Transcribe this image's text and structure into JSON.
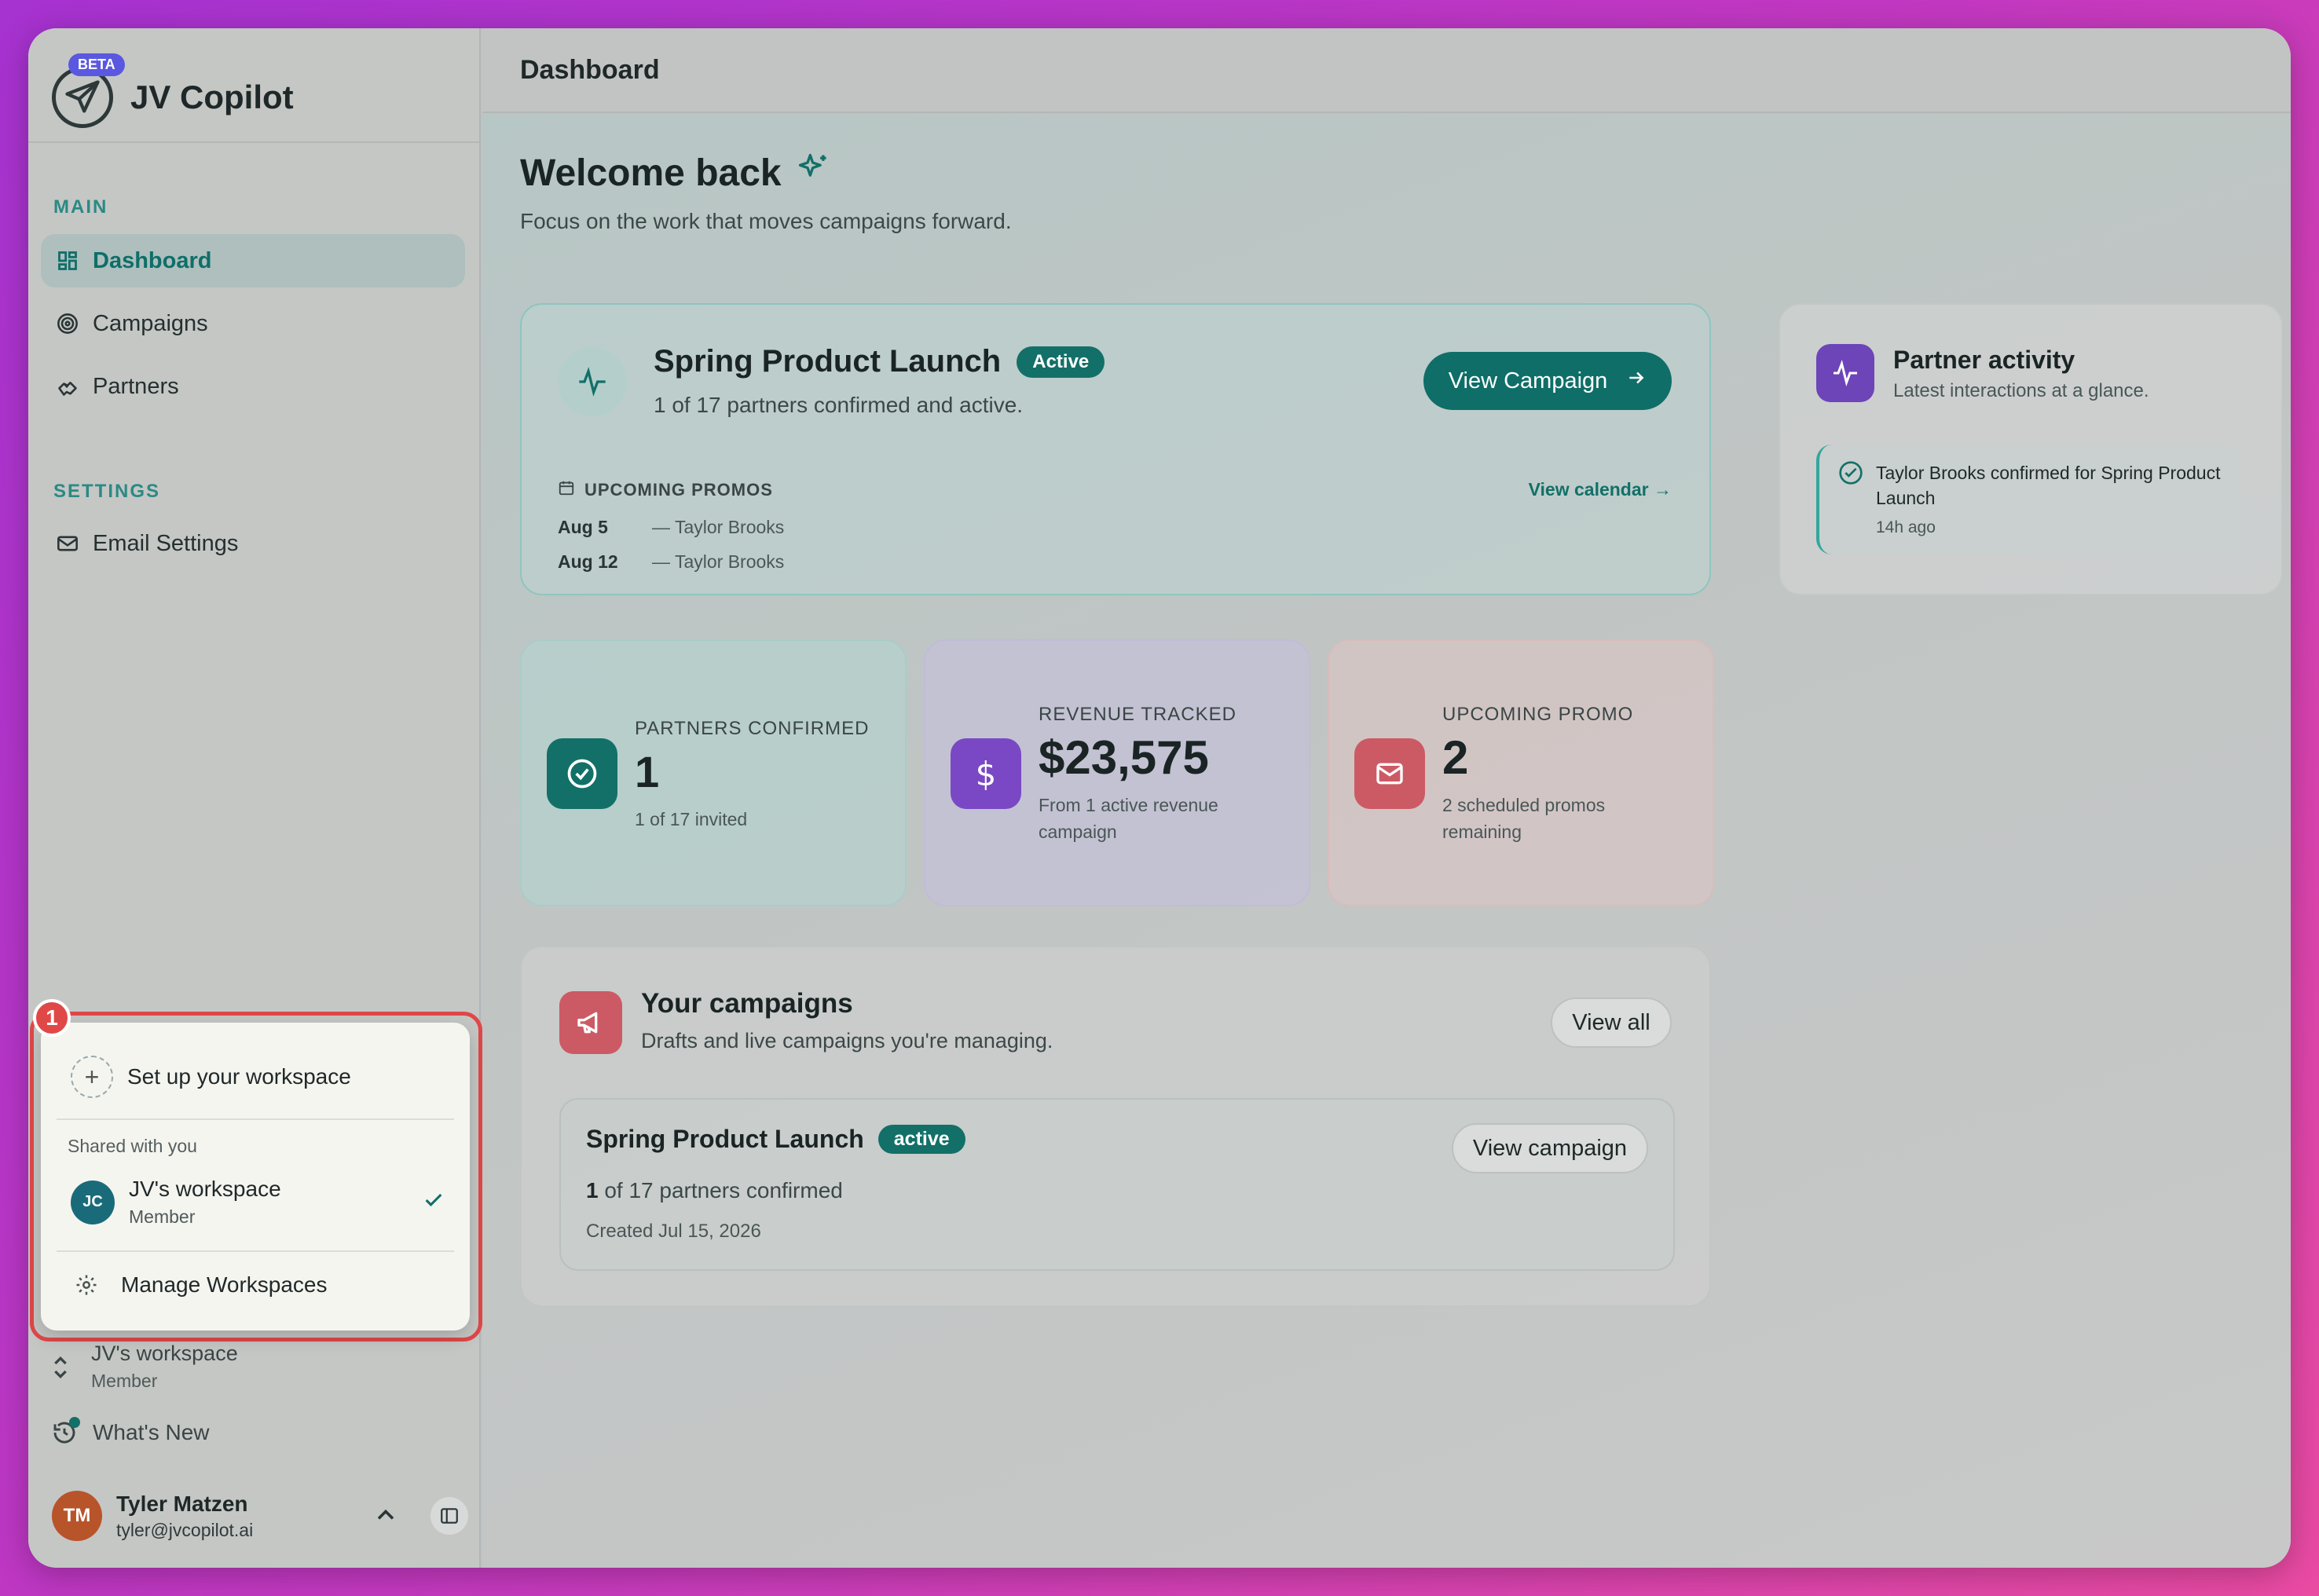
{
  "app": {
    "name": "JV Copilot",
    "beta_label": "BETA"
  },
  "sidebar": {
    "main_label": "MAIN",
    "settings_label": "SETTINGS",
    "items": [
      {
        "label": "Dashboard",
        "icon": "dashboard-grid-icon"
      },
      {
        "label": "Campaigns",
        "icon": "target-icon"
      },
      {
        "label": "Partners",
        "icon": "handshake-icon"
      },
      {
        "label": "Email Settings",
        "icon": "mail-icon"
      }
    ],
    "workspace_menu": {
      "badge": "1",
      "setup_label": "Set up your workspace",
      "shared_label": "Shared with you",
      "workspace_initials": "JC",
      "workspace_name": "JV's workspace",
      "workspace_role": "Member",
      "manage_label": "Manage Workspaces"
    },
    "current_workspace": {
      "name": "JV's workspace",
      "role": "Member"
    },
    "whats_new": "What's New",
    "user": {
      "initials": "TM",
      "name": "Tyler Matzen",
      "email": "tyler@jvcopilot.ai"
    }
  },
  "header": {
    "title": "Dashboard"
  },
  "welcome": {
    "title": "Welcome back",
    "subtitle": "Focus on the work that moves campaigns forward."
  },
  "hero": {
    "title": "Spring Product Launch",
    "status": "Active",
    "subtitle": "1 of 17 partners confirmed and active.",
    "button": "View Campaign",
    "promos_label": "UPCOMING PROMOS",
    "calendar_link": "View calendar →",
    "promos": [
      {
        "date": "Aug 5",
        "partner": "— Taylor Brooks"
      },
      {
        "date": "Aug 12",
        "partner": "— Taylor Brooks"
      }
    ]
  },
  "activity": {
    "title": "Partner activity",
    "subtitle": "Latest interactions at a glance.",
    "items": [
      {
        "text": "Taylor Brooks confirmed for Spring Product Launch",
        "time": "14h ago"
      }
    ]
  },
  "stats": [
    {
      "label": "PARTNERS CONFIRMED",
      "value": "1",
      "sub": "1 of 17 invited",
      "icon": "check-circle-icon",
      "color": "#127068"
    },
    {
      "label": "REVENUE TRACKED",
      "value": "$23,575",
      "sub": "From 1 active revenue campaign",
      "icon": "dollar-icon",
      "color": "#7a48c4"
    },
    {
      "label": "UPCOMING PROMO",
      "value": "2",
      "sub": "2 scheduled promos remaining",
      "icon": "mail-icon",
      "color": "#cc5a64"
    }
  ],
  "campaigns": {
    "title": "Your campaigns",
    "subtitle": "Drafts and live campaigns you're managing.",
    "view_all": "View all",
    "list": [
      {
        "name": "Spring Product Launch",
        "status": "active",
        "confirmed_count": "1",
        "confirmed_text": " of 17 partners confirmed",
        "created": "Created Jul 15, 2026",
        "button": "View campaign"
      }
    ]
  }
}
